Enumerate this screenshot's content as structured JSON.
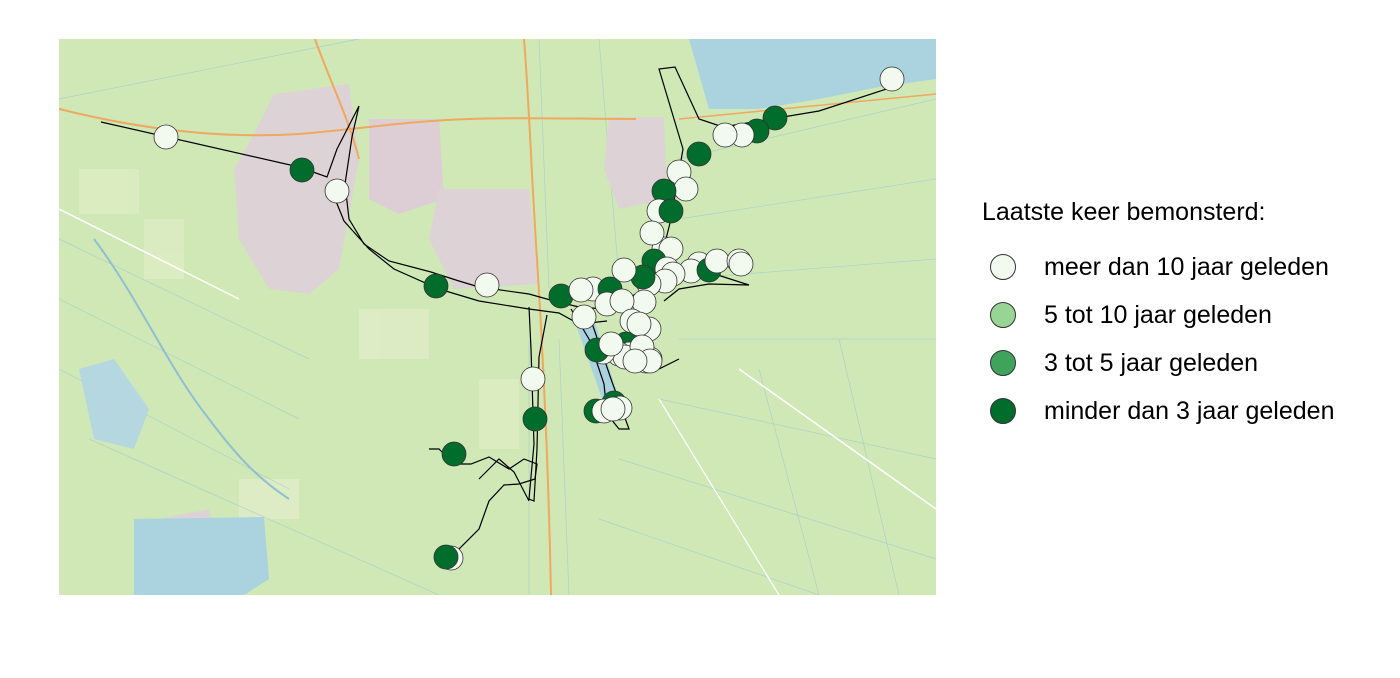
{
  "legend": {
    "title": "Laatste keer bemonsterd:",
    "items": [
      {
        "label": "meer dan 10 jaar geleden",
        "color": "#f2f9ee",
        "category": "older_10"
      },
      {
        "label": "5 tot 10 jaar geleden",
        "color": "#98d494",
        "category": "5_10"
      },
      {
        "label": "3 tot 5 jaar geleden",
        "color": "#3fa35b",
        "category": "3_5"
      },
      {
        "label": "minder dan 3 jaar geleden",
        "color": "#006d2c",
        "category": "recent_3"
      }
    ]
  },
  "map": {
    "basemap": "openstreetmap",
    "colors": {
      "land": "#cfe8b6",
      "water": "#aad3df",
      "urban": "#e0d4da",
      "road": "#f0a860",
      "boundary": "#000000"
    }
  }
}
